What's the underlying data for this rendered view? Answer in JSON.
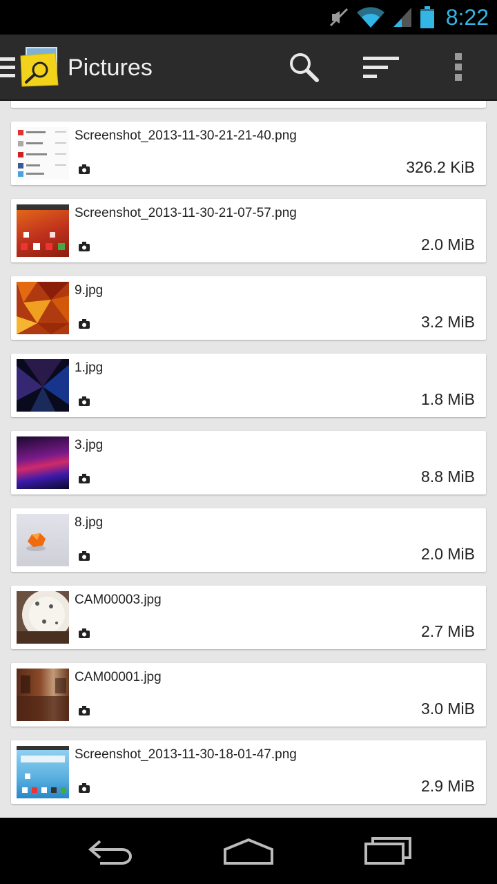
{
  "status": {
    "time": "8:22"
  },
  "actionbar": {
    "title": "Pictures"
  },
  "files": [
    {
      "name": "Screenshot_2013-11-30-21-21-40.png",
      "size": "326.2 KiB"
    },
    {
      "name": "Screenshot_2013-11-30-21-07-57.png",
      "size": "2.0 MiB"
    },
    {
      "name": "9.jpg",
      "size": "3.2 MiB"
    },
    {
      "name": "1.jpg",
      "size": "1.8 MiB"
    },
    {
      "name": "3.jpg",
      "size": "8.8 MiB"
    },
    {
      "name": "8.jpg",
      "size": "2.0 MiB"
    },
    {
      "name": "CAM00003.jpg",
      "size": "2.7 MiB"
    },
    {
      "name": "CAM00001.jpg",
      "size": "3.0 MiB"
    },
    {
      "name": "Screenshot_2013-11-30-18-01-47.png",
      "size": "2.9 MiB"
    }
  ],
  "colors": {
    "accent": "#33b5e5",
    "actionbar": "#2b2b2b",
    "background": "#e6e6e6"
  }
}
